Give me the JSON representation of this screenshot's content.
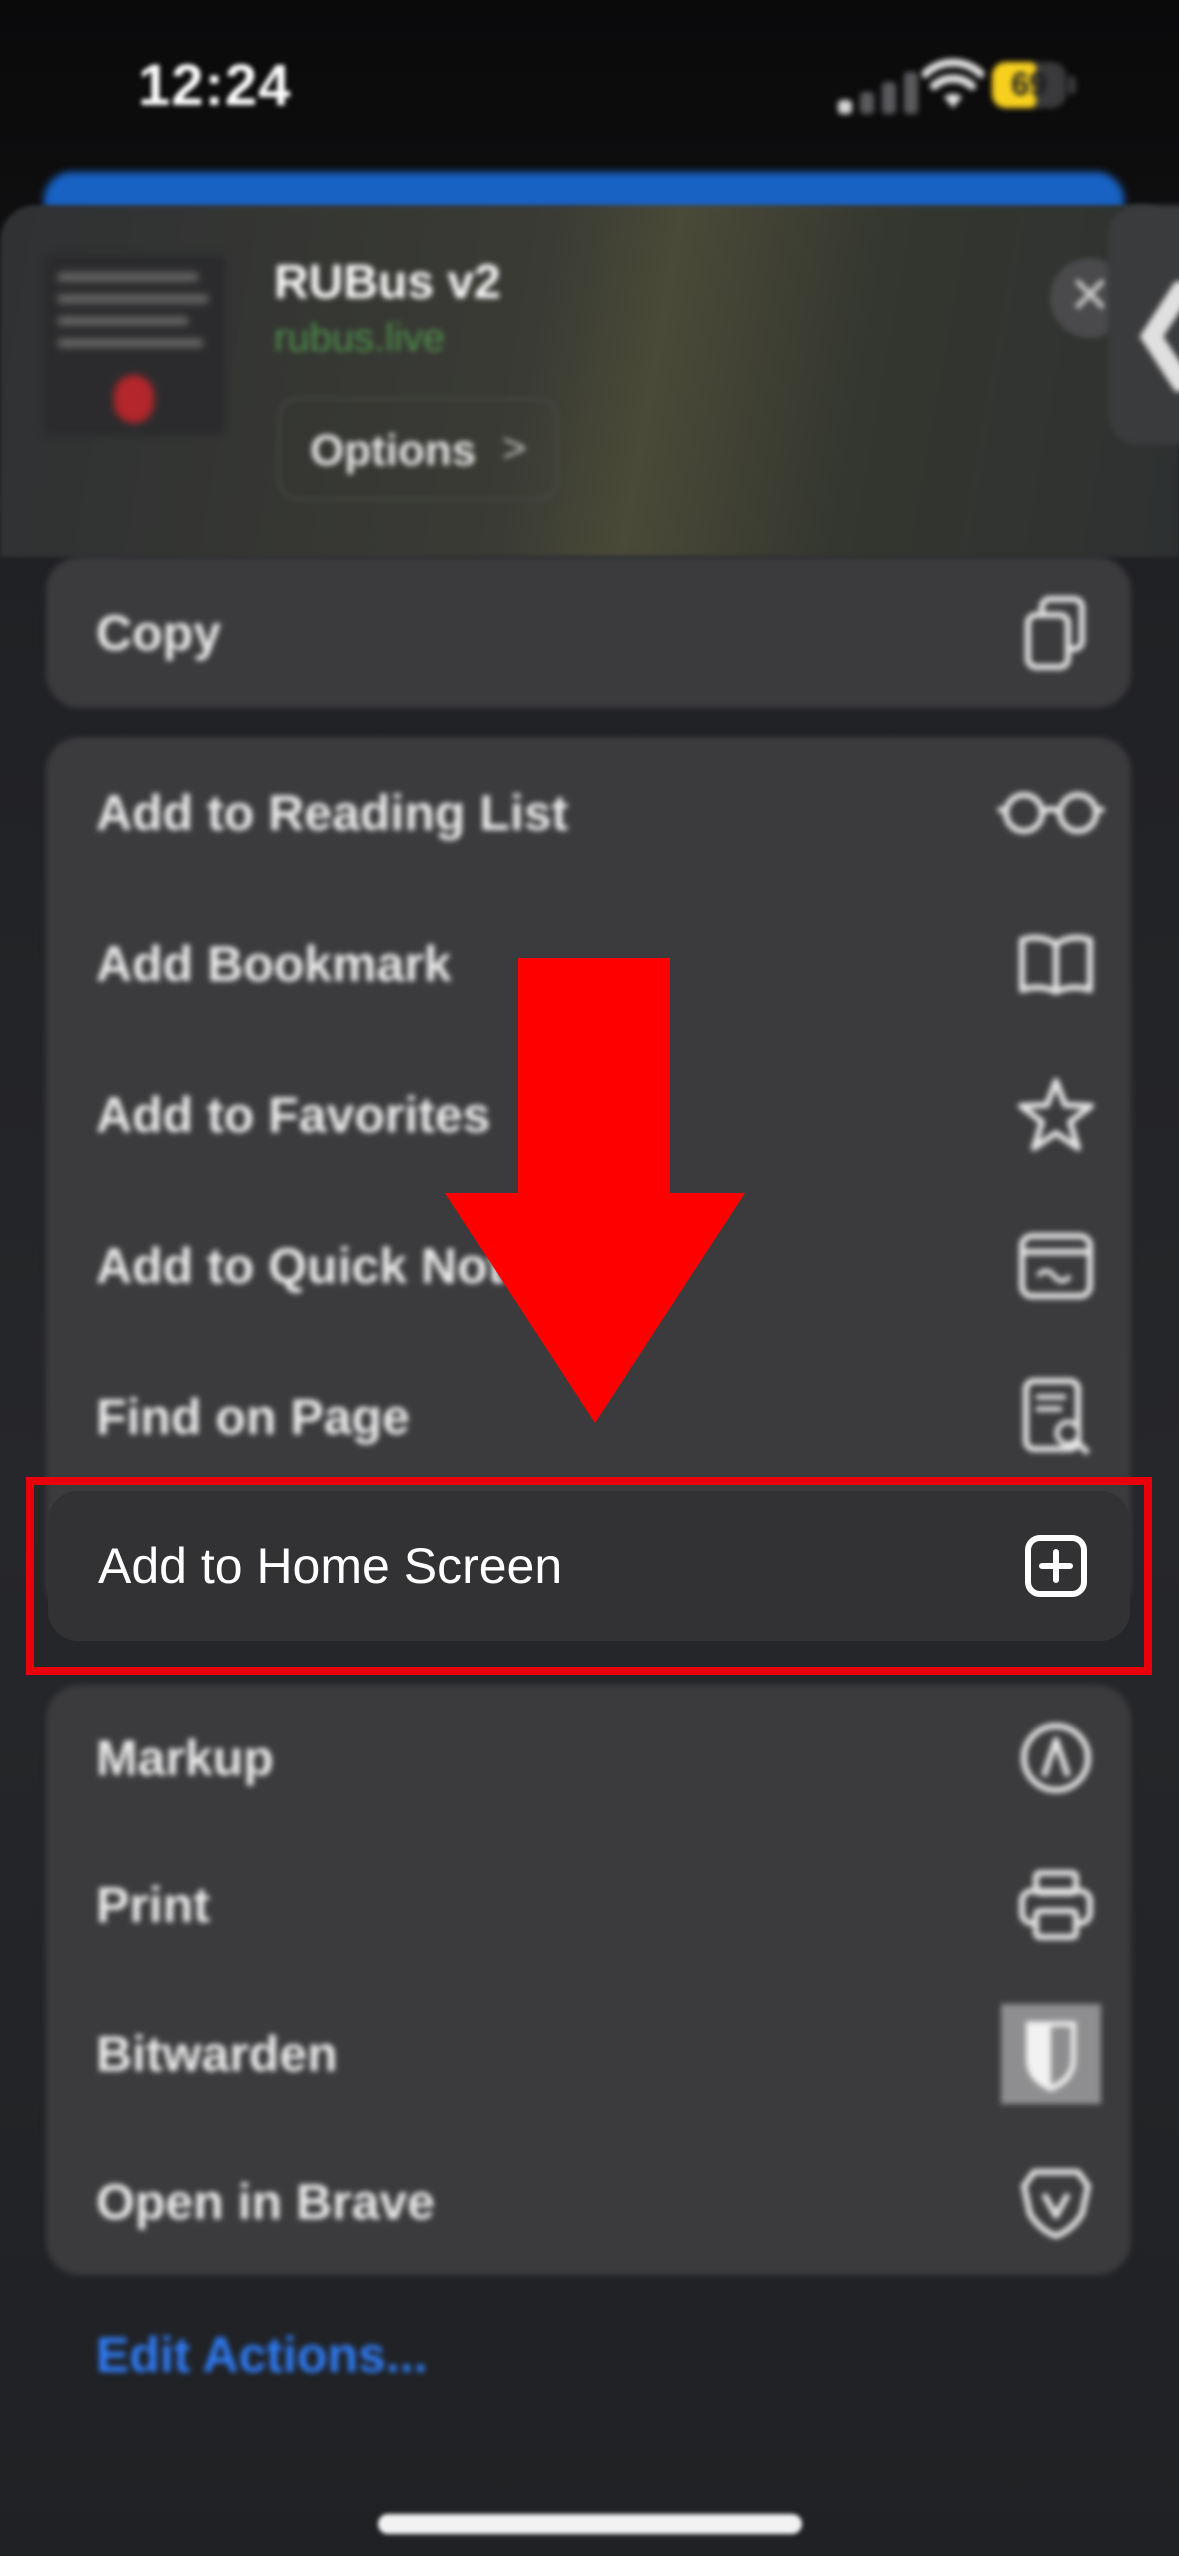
{
  "status_bar": {
    "time": "12:24",
    "battery": "69"
  },
  "share_header": {
    "site_title": "RUBus v2",
    "site_url": "rubus.live",
    "options_label": "Options",
    "options_chevron": ">",
    "close_glyph": "✕",
    "back_glyph": "❮"
  },
  "menu": {
    "copy": {
      "label": "Copy",
      "icon": "copy-icon"
    },
    "group2": [
      {
        "label": "Add to Reading List",
        "icon": "glasses-icon"
      },
      {
        "label": "Add Bookmark",
        "icon": "book-icon"
      },
      {
        "label": "Add to Favorites",
        "icon": "star-icon"
      },
      {
        "label": "Add to Quick Note",
        "icon": "quick-note-icon"
      },
      {
        "label": "Find on Page",
        "icon": "find-on-page-icon"
      }
    ],
    "highlighted": {
      "label": "Add to Home Screen",
      "icon": "plus-square-icon"
    },
    "group3": [
      {
        "label": "Markup",
        "icon": "markup-icon"
      },
      {
        "label": "Print",
        "icon": "printer-icon"
      },
      {
        "label": "Bitwarden",
        "icon": "bitwarden-shield-icon"
      },
      {
        "label": "Open in Brave",
        "icon": "brave-lion-icon"
      }
    ],
    "edit_actions": "Edit Actions..."
  },
  "colors": {
    "annotation_red": "#e8000b",
    "link_blue": "#2f7cf6",
    "battery_yellow": "#f7d01e",
    "strip_blue": "#1862c4"
  }
}
